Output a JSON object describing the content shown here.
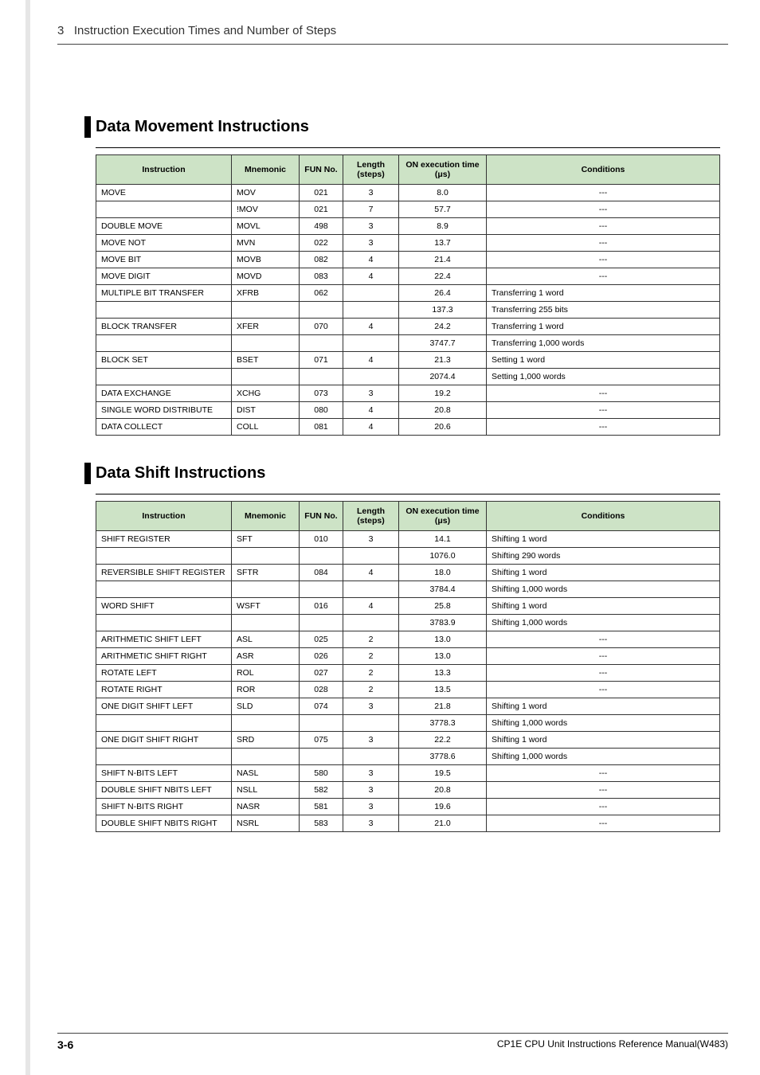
{
  "header": {
    "section_num": "3",
    "section_title": "Instruction Execution Times and Number of Steps"
  },
  "sections": [
    {
      "title": "Data Movement Instructions",
      "cols": [
        "Instruction",
        "Mnemonic",
        "FUN No.",
        "Length (steps)",
        "ON execution time (μs)",
        "Conditions"
      ],
      "rows": [
        {
          "instr": "MOVE",
          "mn": "MOV",
          "fun": "021",
          "len": "3",
          "on": "8.0",
          "cond": "---",
          "cc": true
        },
        {
          "instr": "",
          "mn": "!MOV",
          "fun": "021",
          "len": "7",
          "on": "57.7",
          "cond": "---",
          "cc": true
        },
        {
          "instr": "DOUBLE MOVE",
          "mn": "MOVL",
          "fun": "498",
          "len": "3",
          "on": "8.9",
          "cond": "---",
          "cc": true
        },
        {
          "instr": "MOVE NOT",
          "mn": "MVN",
          "fun": "022",
          "len": "3",
          "on": "13.7",
          "cond": "---",
          "cc": true
        },
        {
          "instr": "MOVE BIT",
          "mn": "MOVB",
          "fun": "082",
          "len": "4",
          "on": "21.4",
          "cond": "---",
          "cc": true
        },
        {
          "instr": "MOVE DIGIT",
          "mn": "MOVD",
          "fun": "083",
          "len": "4",
          "on": "22.4",
          "cond": "---",
          "cc": true
        },
        {
          "instr": "MULTIPLE BIT TRANSFER",
          "mn": "XFRB",
          "fun": "062",
          "len": "",
          "on": "26.4",
          "cond": "Transferring 1 word"
        },
        {
          "instr": "",
          "mn": "",
          "fun": "",
          "len": "",
          "on": "137.3",
          "cond": "Transferring 255 bits"
        },
        {
          "instr": "BLOCK TRANSFER",
          "mn": "XFER",
          "fun": "070",
          "len": "4",
          "on": "24.2",
          "cond": "Transferring 1 word"
        },
        {
          "instr": "",
          "mn": "",
          "fun": "",
          "len": "",
          "on": "3747.7",
          "cond": "Transferring 1,000 words"
        },
        {
          "instr": "BLOCK SET",
          "mn": "BSET",
          "fun": "071",
          "len": "4",
          "on": "21.3",
          "cond": "Setting 1 word"
        },
        {
          "instr": "",
          "mn": "",
          "fun": "",
          "len": "",
          "on": "2074.4",
          "cond": "Setting 1,000 words"
        },
        {
          "instr": "DATA EXCHANGE",
          "mn": "XCHG",
          "fun": "073",
          "len": "3",
          "on": "19.2",
          "cond": "---",
          "cc": true
        },
        {
          "instr": "SINGLE WORD DISTRIBUTE",
          "mn": "DIST",
          "fun": "080",
          "len": "4",
          "on": "20.8",
          "cond": "---",
          "cc": true
        },
        {
          "instr": "DATA COLLECT",
          "mn": "COLL",
          "fun": "081",
          "len": "4",
          "on": "20.6",
          "cond": "---",
          "cc": true
        }
      ]
    },
    {
      "title": "Data Shift Instructions",
      "cols": [
        "Instruction",
        "Mnemonic",
        "FUN No.",
        "Length (steps)",
        "ON execution time (μs)",
        "Conditions"
      ],
      "rows": [
        {
          "instr": "SHIFT REGISTER",
          "mn": "SFT",
          "fun": "010",
          "len": "3",
          "on": "14.1",
          "cond": "Shifting 1 word"
        },
        {
          "instr": "",
          "mn": "",
          "fun": "",
          "len": "",
          "on": "1076.0",
          "cond": "Shifting 290 words"
        },
        {
          "instr": "REVERSIBLE SHIFT REGISTER",
          "mn": "SFTR",
          "fun": "084",
          "len": "4",
          "on": "18.0",
          "cond": "Shifting 1 word"
        },
        {
          "instr": "",
          "mn": "",
          "fun": "",
          "len": "",
          "on": "3784.4",
          "cond": "Shifting 1,000 words"
        },
        {
          "instr": "WORD SHIFT",
          "mn": "WSFT",
          "fun": "016",
          "len": "4",
          "on": "25.8",
          "cond": "Shifting 1 word"
        },
        {
          "instr": "",
          "mn": "",
          "fun": "",
          "len": "",
          "on": "3783.9",
          "cond": "Shifting 1,000 words"
        },
        {
          "instr": "ARITHMETIC SHIFT LEFT",
          "mn": "ASL",
          "fun": "025",
          "len": "2",
          "on": "13.0",
          "cond": "---",
          "cc": true
        },
        {
          "instr": "ARITHMETIC SHIFT RIGHT",
          "mn": "ASR",
          "fun": "026",
          "len": "2",
          "on": "13.0",
          "cond": "---",
          "cc": true
        },
        {
          "instr": "ROTATE LEFT",
          "mn": "ROL",
          "fun": "027",
          "len": "2",
          "on": "13.3",
          "cond": "---",
          "cc": true
        },
        {
          "instr": "ROTATE RIGHT",
          "mn": "ROR",
          "fun": "028",
          "len": "2",
          "on": "13.5",
          "cond": "---",
          "cc": true
        },
        {
          "instr": "ONE DIGIT SHIFT LEFT",
          "mn": "SLD",
          "fun": "074",
          "len": "3",
          "on": "21.8",
          "cond": "Shifting 1 word"
        },
        {
          "instr": "",
          "mn": "",
          "fun": "",
          "len": "",
          "on": "3778.3",
          "cond": "Shifting 1,000 words"
        },
        {
          "instr": "ONE DIGIT SHIFT RIGHT",
          "mn": "SRD",
          "fun": "075",
          "len": "3",
          "on": "22.2",
          "cond": "Shifting 1 word"
        },
        {
          "instr": "",
          "mn": "",
          "fun": "",
          "len": "",
          "on": "3778.6",
          "cond": "Shifting 1,000 words"
        },
        {
          "instr": "SHIFT N-BITS LEFT",
          "mn": "NASL",
          "fun": "580",
          "len": "3",
          "on": "19.5",
          "cond": "---",
          "cc": true
        },
        {
          "instr": "DOUBLE SHIFT NBITS LEFT",
          "mn": "NSLL",
          "fun": "582",
          "len": "3",
          "on": "20.8",
          "cond": "---",
          "cc": true
        },
        {
          "instr": "SHIFT N-BITS RIGHT",
          "mn": "NASR",
          "fun": "581",
          "len": "3",
          "on": "19.6",
          "cond": "---",
          "cc": true
        },
        {
          "instr": "DOUBLE SHIFT NBITS RIGHT",
          "mn": "NSRL",
          "fun": "583",
          "len": "3",
          "on": "21.0",
          "cond": "---",
          "cc": true
        }
      ]
    }
  ],
  "footer": {
    "page": "3-6",
    "manual": "CP1E CPU Unit Instructions Reference Manual(W483)"
  }
}
